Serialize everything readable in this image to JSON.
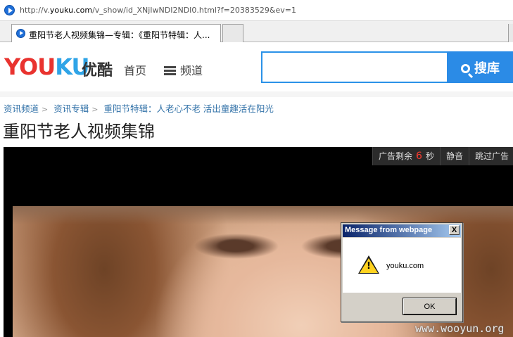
{
  "browser": {
    "address": {
      "prefix": "http://v.",
      "domain": "youku.com",
      "path": "/v_show/id_XNjIwNDI2NDI0.html?f=20383529&ev=1"
    },
    "tab_title": "重阳节老人视频集锦—专辑：《重阳节特辑：人..."
  },
  "header": {
    "logo_you": "YOU",
    "logo_ku": "KU",
    "logo_cn": "优酷",
    "nav_home": "首页",
    "nav_channel": "频道",
    "search_placeholder": "",
    "search_label": "搜库",
    "colors": {
      "brand_red": "#e9332f",
      "brand_blue": "#2fa4e7",
      "search_blue": "#2b8be6"
    }
  },
  "breadcrumb": [
    "资讯频道",
    "资讯专辑",
    "重阳节特辑：人老心不老 活出童趣活在阳光"
  ],
  "page_title": "重阳节老人视频集锦",
  "player": {
    "ad_remaining_label": "广告剩余",
    "ad_seconds": "6",
    "ad_seconds_unit": "秒",
    "mute_label": "静音",
    "skip_label": "跳过广告"
  },
  "dialog": {
    "title": "Message from webpage",
    "message": "youku.com",
    "ok_label": "OK",
    "close_glyph": "X",
    "icon": "warning-icon"
  },
  "watermark": "www.wooyun.org"
}
